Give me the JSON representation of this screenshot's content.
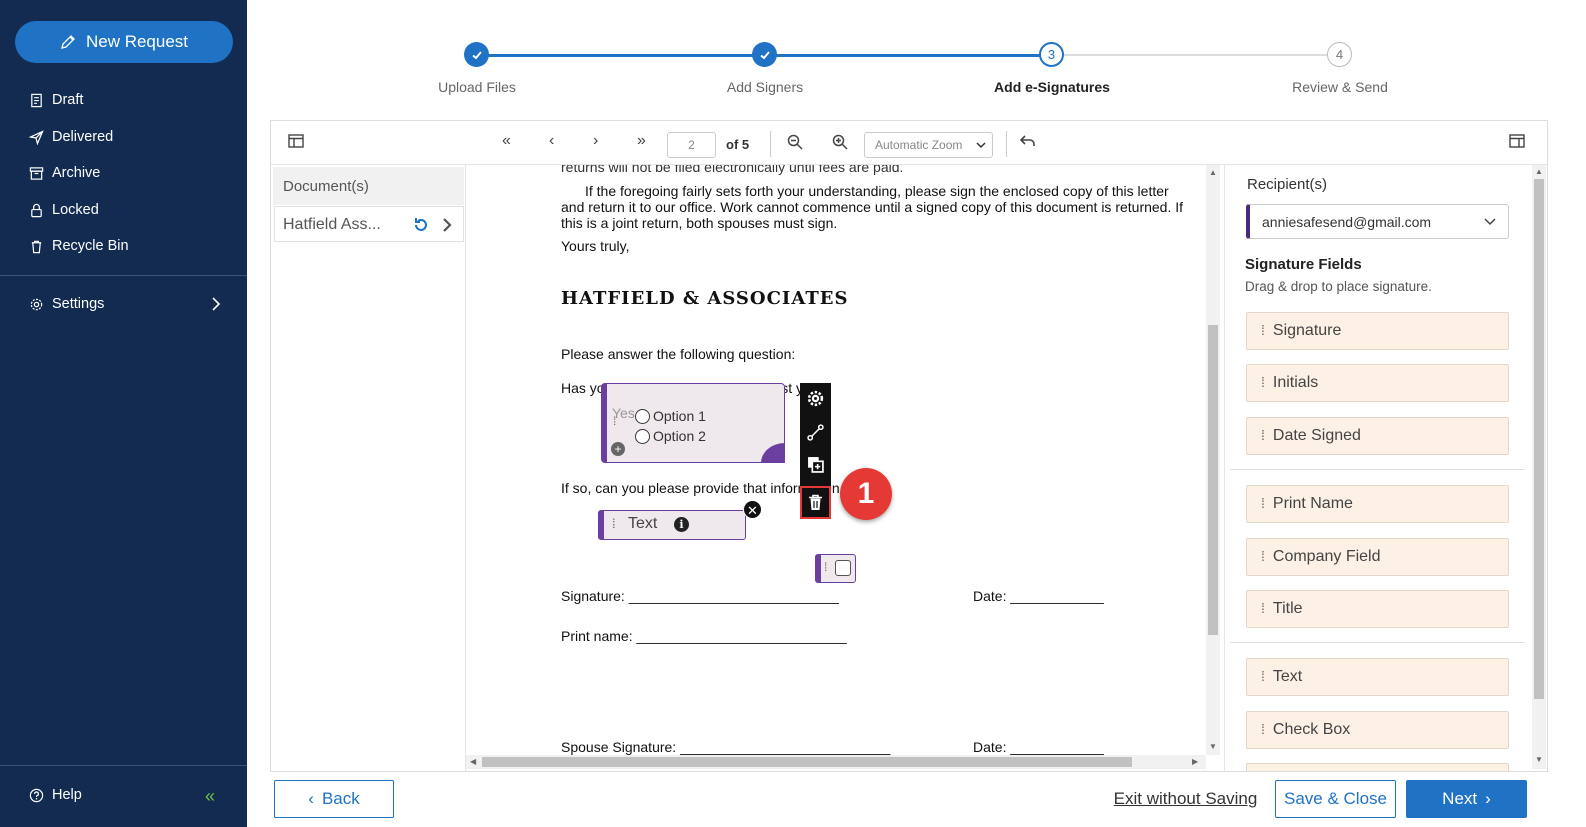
{
  "sidebar": {
    "new_request": "New Request",
    "items": [
      {
        "label": "Draft"
      },
      {
        "label": "Delivered"
      },
      {
        "label": "Archive"
      },
      {
        "label": "Locked"
      },
      {
        "label": "Recycle Bin"
      }
    ],
    "settings": "Settings",
    "help": "Help"
  },
  "stepper": {
    "steps": [
      {
        "label": "Upload Files",
        "status": "done"
      },
      {
        "label": "Add Signers",
        "status": "done"
      },
      {
        "label": "Add e-Signatures",
        "status": "current",
        "number": "3"
      },
      {
        "label": "Review & Send",
        "status": "pending",
        "number": "4"
      }
    ]
  },
  "toolbar": {
    "page_value": "2",
    "of_pages": "of 5",
    "zoom": "Automatic Zoom"
  },
  "documents": {
    "header": "Document(s)",
    "items": [
      {
        "name": "Hatfield Ass..."
      }
    ]
  },
  "page": {
    "top_cut": "returns will not be filed electronically until fees are paid.",
    "para": [
      "If the foregoing fairly sets forth your understanding, please sign the enclosed copy of this letter",
      "and return it to our office. Work cannot commence until a signed copy of this document is returned. If",
      "this is a joint return, both spouses must sign."
    ],
    "yours": "Yours truly,",
    "firm": "HATFIELD & ASSOCIATES",
    "question_intro": "Please answer the following question:",
    "question": "Has your address changed in the last year?",
    "followup": "If so, can you please provide that information",
    "signature": "Signature: ___________________________",
    "date1": "Date: ____________",
    "print_name": "Print name: ___________________________",
    "spouse": "Spouse Signature: ___________________________",
    "date2": "Date: ____________"
  },
  "fields": {
    "radio_options": [
      "Option 1",
      "Option 2"
    ],
    "behind_yes": "Yes",
    "text_field": "Text",
    "callout_number": "1"
  },
  "right_panel": {
    "recipients_label": "Recipient(s)",
    "recipient": "anniesafesend@gmail.com",
    "sig_fields_label": "Signature Fields",
    "sig_fields_hint": "Drag & drop to place signature.",
    "group1": [
      "Signature",
      "Initials",
      "Date Signed"
    ],
    "group2": [
      "Print Name",
      "Company Field",
      "Title"
    ],
    "group3": [
      "Text",
      "Check Box"
    ]
  },
  "footer": {
    "back": "Back",
    "exit": "Exit without Saving",
    "save_close": "Save & Close",
    "next": "Next"
  },
  "colors": {
    "sidebar_bg": "#132b50",
    "accent_blue": "#1f72c4",
    "field_purple": "#6b3fa0",
    "callout_red": "#e53935",
    "field_bg": "#fdf1e6"
  }
}
